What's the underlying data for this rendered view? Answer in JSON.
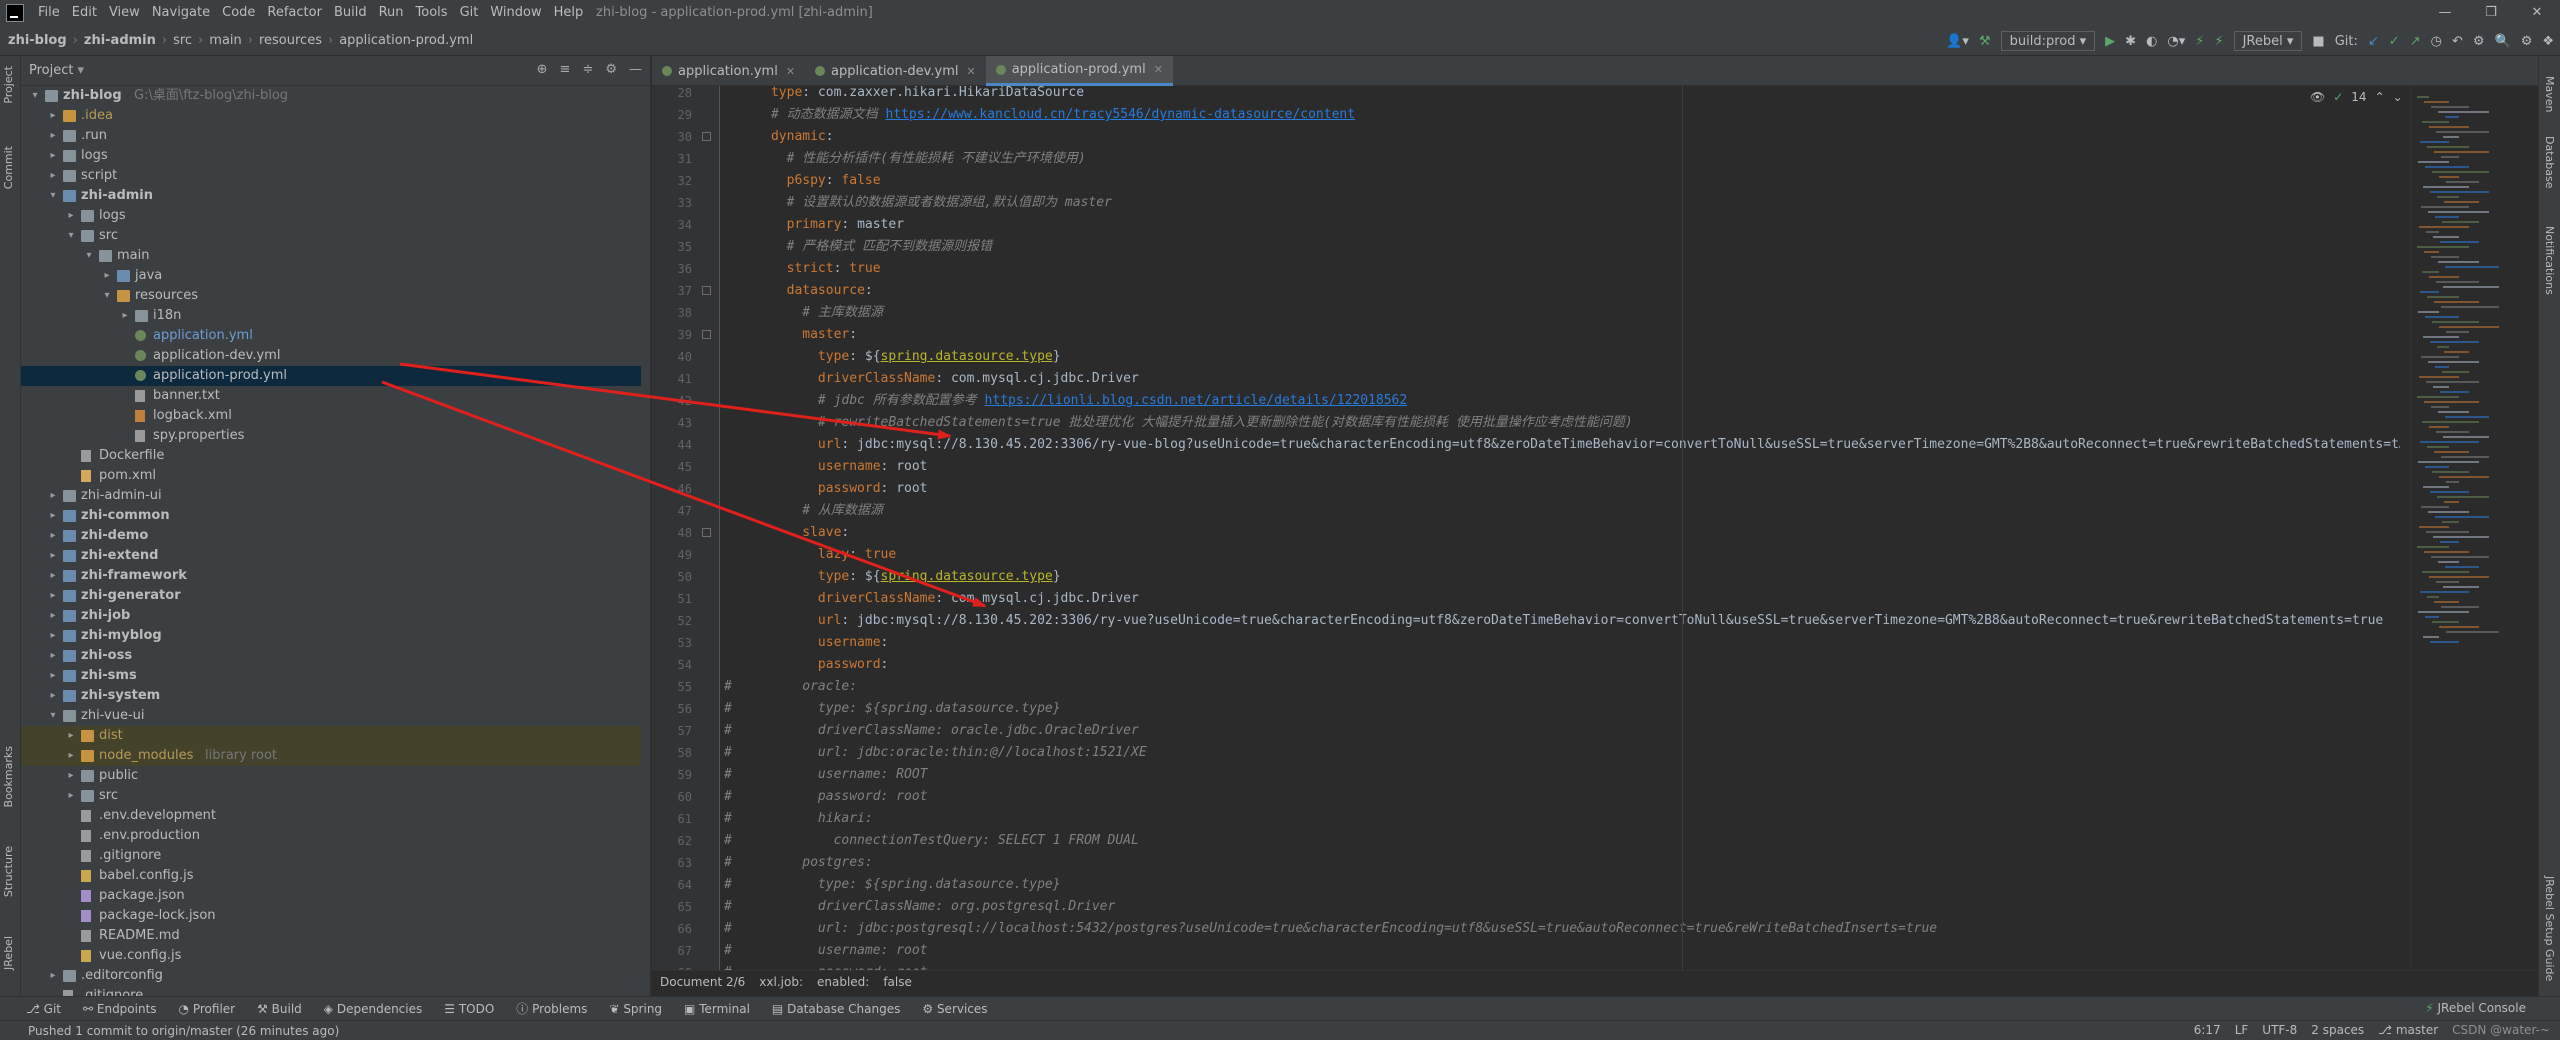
{
  "window": {
    "title": "zhi-blog - application-prod.yml [zhi-admin]",
    "menu": [
      "File",
      "Edit",
      "View",
      "Navigate",
      "Code",
      "Refactor",
      "Build",
      "Run",
      "Tools",
      "Git",
      "Window",
      "Help"
    ],
    "controls": [
      "—",
      "❐",
      "✕"
    ]
  },
  "navbar": {
    "crumbs": [
      "zhi-blog",
      "zhi-admin",
      "src",
      "main",
      "resources",
      "application-prod.yml"
    ],
    "run_config": "build:prod",
    "jrebel": "JRebel",
    "git_label": "Git:"
  },
  "project": {
    "title": "Project",
    "tree": [
      {
        "depth": 0,
        "arrow": "v",
        "icon": "folder",
        "label": "zhi-blog",
        "extra": "G:\\桌面\\ftz-blog\\zhi-blog",
        "cls": "bold"
      },
      {
        "depth": 1,
        "arrow": ">",
        "icon": "folder-orange",
        "label": ".idea",
        "cls": "excluded"
      },
      {
        "depth": 1,
        "arrow": ">",
        "icon": "folder",
        "label": ".run",
        "cls": ""
      },
      {
        "depth": 1,
        "arrow": ">",
        "icon": "folder",
        "label": "logs",
        "cls": ""
      },
      {
        "depth": 1,
        "arrow": ">",
        "icon": "folder",
        "label": "script",
        "cls": ""
      },
      {
        "depth": 1,
        "arrow": "v",
        "icon": "folder-blue",
        "label": "zhi-admin",
        "cls": "bold"
      },
      {
        "depth": 2,
        "arrow": ">",
        "icon": "folder",
        "label": "logs",
        "cls": ""
      },
      {
        "depth": 2,
        "arrow": "v",
        "icon": "folder",
        "label": "src",
        "cls": ""
      },
      {
        "depth": 3,
        "arrow": "v",
        "icon": "folder",
        "label": "main",
        "cls": ""
      },
      {
        "depth": 4,
        "arrow": ">",
        "icon": "folder-blue",
        "label": "java",
        "cls": ""
      },
      {
        "depth": 4,
        "arrow": "v",
        "icon": "folder-orange",
        "label": "resources",
        "cls": ""
      },
      {
        "depth": 5,
        "arrow": ">",
        "icon": "folder",
        "label": "i18n",
        "cls": ""
      },
      {
        "depth": 5,
        "arrow": "",
        "icon": "yml",
        "label": "application.yml",
        "cls": "blue-t"
      },
      {
        "depth": 5,
        "arrow": "",
        "icon": "yml",
        "label": "application-dev.yml",
        "cls": ""
      },
      {
        "depth": 5,
        "arrow": "",
        "icon": "yml",
        "label": "application-prod.yml",
        "cls": "",
        "selected": true
      },
      {
        "depth": 5,
        "arrow": "",
        "icon": "txt",
        "label": "banner.txt",
        "cls": ""
      },
      {
        "depth": 5,
        "arrow": "",
        "icon": "xml",
        "label": "logback.xml",
        "cls": ""
      },
      {
        "depth": 5,
        "arrow": "",
        "icon": "txt",
        "label": "spy.properties",
        "cls": ""
      },
      {
        "depth": 2,
        "arrow": "",
        "icon": "txt",
        "label": "Dockerfile",
        "cls": ""
      },
      {
        "depth": 2,
        "arrow": "",
        "icon": "m",
        "label": "pom.xml",
        "cls": ""
      },
      {
        "depth": 1,
        "arrow": ">",
        "icon": "folder",
        "label": "zhi-admin-ui",
        "cls": ""
      },
      {
        "depth": 1,
        "arrow": ">",
        "icon": "folder-blue",
        "label": "zhi-common",
        "cls": "bold"
      },
      {
        "depth": 1,
        "arrow": ">",
        "icon": "folder-blue",
        "label": "zhi-demo",
        "cls": "bold"
      },
      {
        "depth": 1,
        "arrow": ">",
        "icon": "folder-blue",
        "label": "zhi-extend",
        "cls": "bold"
      },
      {
        "depth": 1,
        "arrow": ">",
        "icon": "folder-blue",
        "label": "zhi-framework",
        "cls": "bold"
      },
      {
        "depth": 1,
        "arrow": ">",
        "icon": "folder-blue",
        "label": "zhi-generator",
        "cls": "bold"
      },
      {
        "depth": 1,
        "arrow": ">",
        "icon": "folder-blue",
        "label": "zhi-job",
        "cls": "bold"
      },
      {
        "depth": 1,
        "arrow": ">",
        "icon": "folder-blue",
        "label": "zhi-myblog",
        "cls": "bold"
      },
      {
        "depth": 1,
        "arrow": ">",
        "icon": "folder-blue",
        "label": "zhi-oss",
        "cls": "bold"
      },
      {
        "depth": 1,
        "arrow": ">",
        "icon": "folder-blue",
        "label": "zhi-sms",
        "cls": "bold"
      },
      {
        "depth": 1,
        "arrow": ">",
        "icon": "folder-blue",
        "label": "zhi-system",
        "cls": "bold"
      },
      {
        "depth": 1,
        "arrow": "v",
        "icon": "folder",
        "label": "zhi-vue-ui",
        "cls": ""
      },
      {
        "depth": 2,
        "arrow": ">",
        "icon": "folder-orange",
        "label": "dist",
        "cls": "excluded",
        "bg": "excluded"
      },
      {
        "depth": 2,
        "arrow": ">",
        "icon": "folder-orange",
        "label": "node_modules",
        "extra": "library root",
        "cls": "excluded",
        "bg": "excluded"
      },
      {
        "depth": 2,
        "arrow": ">",
        "icon": "folder",
        "label": "public",
        "cls": ""
      },
      {
        "depth": 2,
        "arrow": ">",
        "icon": "folder",
        "label": "src",
        "cls": ""
      },
      {
        "depth": 2,
        "arrow": "",
        "icon": "txt",
        "label": ".env.development",
        "cls": ""
      },
      {
        "depth": 2,
        "arrow": "",
        "icon": "txt",
        "label": ".env.production",
        "cls": ""
      },
      {
        "depth": 2,
        "arrow": "",
        "icon": "txt",
        "label": ".gitignore",
        "cls": ""
      },
      {
        "depth": 2,
        "arrow": "",
        "icon": "js",
        "label": "babel.config.js",
        "cls": ""
      },
      {
        "depth": 2,
        "arrow": "",
        "icon": "json",
        "label": "package.json",
        "cls": ""
      },
      {
        "depth": 2,
        "arrow": "",
        "icon": "json",
        "label": "package-lock.json",
        "cls": ""
      },
      {
        "depth": 2,
        "arrow": "",
        "icon": "txt",
        "label": "README.md",
        "cls": ""
      },
      {
        "depth": 2,
        "arrow": "",
        "icon": "js",
        "label": "vue.config.js",
        "cls": ""
      },
      {
        "depth": 1,
        "arrow": ">",
        "icon": "folder",
        "label": ".editorconfig",
        "cls": ""
      },
      {
        "depth": 1,
        "arrow": "",
        "icon": "txt",
        "label": ".gitignore",
        "cls": ""
      }
    ]
  },
  "tabs": [
    {
      "label": "application.yml",
      "active": false
    },
    {
      "label": "application-dev.yml",
      "active": false
    },
    {
      "label": "application-prod.yml",
      "active": true
    }
  ],
  "editor": {
    "inspection_count": "14",
    "lines": [
      {
        "n": "28",
        "segs": [
          [
            "t",
            "      "
          ],
          [
            "k",
            "type"
          ],
          [
            "t",
            ": com.zaxxer.hikari.HikariDataSource"
          ]
        ]
      },
      {
        "n": "29",
        "segs": [
          [
            "t",
            "      "
          ],
          [
            "c",
            "# 动态数据源文档 "
          ],
          [
            "u",
            "https://www.kancloud.cn/tracy5546/dynamic-datasource/content"
          ]
        ]
      },
      {
        "n": "30",
        "segs": [
          [
            "t",
            "      "
          ],
          [
            "k",
            "dynamic"
          ],
          [
            "t",
            ":"
          ]
        ]
      },
      {
        "n": "31",
        "segs": [
          [
            "t",
            "        "
          ],
          [
            "c",
            "# 性能分析插件(有性能损耗 不建议生产环境使用)"
          ]
        ]
      },
      {
        "n": "32",
        "segs": [
          [
            "t",
            "        "
          ],
          [
            "k",
            "p6spy"
          ],
          [
            "t",
            ": "
          ],
          [
            "k",
            "false"
          ]
        ]
      },
      {
        "n": "33",
        "segs": [
          [
            "t",
            "        "
          ],
          [
            "c",
            "# 设置默认的数据源或者数据源组,默认值即为 master"
          ]
        ]
      },
      {
        "n": "34",
        "segs": [
          [
            "t",
            "        "
          ],
          [
            "k",
            "primary"
          ],
          [
            "t",
            ": master"
          ]
        ]
      },
      {
        "n": "35",
        "segs": [
          [
            "t",
            "        "
          ],
          [
            "c",
            "# 严格模式 匹配不到数据源则报错"
          ]
        ]
      },
      {
        "n": "36",
        "segs": [
          [
            "t",
            "        "
          ],
          [
            "k",
            "strict"
          ],
          [
            "t",
            ": "
          ],
          [
            "k",
            "true"
          ]
        ]
      },
      {
        "n": "37",
        "segs": [
          [
            "t",
            "        "
          ],
          [
            "k",
            "datasource"
          ],
          [
            "t",
            ":"
          ]
        ]
      },
      {
        "n": "38",
        "segs": [
          [
            "t",
            "          "
          ],
          [
            "c",
            "# 主库数据源"
          ]
        ]
      },
      {
        "n": "39",
        "segs": [
          [
            "t",
            "          "
          ],
          [
            "k",
            "master"
          ],
          [
            "t",
            ":"
          ]
        ]
      },
      {
        "n": "40",
        "segs": [
          [
            "t",
            "            "
          ],
          [
            "k",
            "type"
          ],
          [
            "t",
            ": ${"
          ],
          [
            "ph",
            "spring.datasource.type"
          ],
          [
            "t",
            "}"
          ]
        ]
      },
      {
        "n": "41",
        "segs": [
          [
            "t",
            "            "
          ],
          [
            "k",
            "driverClassName"
          ],
          [
            "t",
            ": com.mysql.cj.jdbc.Driver"
          ]
        ]
      },
      {
        "n": "42",
        "segs": [
          [
            "t",
            "            "
          ],
          [
            "c",
            "# jdbc 所有参数配置参考 "
          ],
          [
            "u",
            "https://lionli.blog.csdn.net/article/details/122018562"
          ]
        ]
      },
      {
        "n": "43",
        "segs": [
          [
            "t",
            "            "
          ],
          [
            "c",
            "# rewriteBatchedStatements=true 批处理优化 大幅提升批量插入更新删除性能(对数据库有性能损耗 使用批量操作应考虑性能问题)"
          ]
        ]
      },
      {
        "n": "44",
        "segs": [
          [
            "t",
            "            "
          ],
          [
            "k",
            "url"
          ],
          [
            "t",
            ": jdbc:mysql://8.130.45.202:3306/ry-vue-blog?useUnicode=true&characterEncoding=utf8&zeroDateTimeBehavior=convertToNull&useSSL=true&serverTimezone=GMT%2B8&autoReconnect=true&rewriteBatchedStatements=t…"
          ]
        ]
      },
      {
        "n": "45",
        "segs": [
          [
            "t",
            "            "
          ],
          [
            "k",
            "username"
          ],
          [
            "t",
            ": root"
          ]
        ]
      },
      {
        "n": "46",
        "segs": [
          [
            "t",
            "            "
          ],
          [
            "k",
            "password"
          ],
          [
            "t",
            ": root"
          ]
        ]
      },
      {
        "n": "47",
        "segs": [
          [
            "t",
            "          "
          ],
          [
            "c",
            "# 从库数据源"
          ]
        ]
      },
      {
        "n": "48",
        "segs": [
          [
            "t",
            "          "
          ],
          [
            "k",
            "slave"
          ],
          [
            "t",
            ":"
          ]
        ]
      },
      {
        "n": "49",
        "segs": [
          [
            "t",
            "            "
          ],
          [
            "k",
            "lazy"
          ],
          [
            "t",
            ": "
          ],
          [
            "k",
            "true"
          ]
        ]
      },
      {
        "n": "50",
        "segs": [
          [
            "t",
            "            "
          ],
          [
            "k",
            "type"
          ],
          [
            "t",
            ": ${"
          ],
          [
            "ph",
            "spring.datasource.type"
          ],
          [
            "t",
            "}"
          ]
        ]
      },
      {
        "n": "51",
        "segs": [
          [
            "t",
            "            "
          ],
          [
            "k",
            "driverClassName"
          ],
          [
            "t",
            ": com.mysql.cj.jdbc.Driver"
          ]
        ]
      },
      {
        "n": "52",
        "segs": [
          [
            "t",
            "            "
          ],
          [
            "k",
            "url"
          ],
          [
            "t",
            ": jdbc:mysql://8.130.45.202:3306/ry-vue?useUnicode=true&characterEncoding=utf8&zeroDateTimeBehavior=convertToNull&useSSL=true&serverTimezone=GMT%2B8&autoReconnect=true&rewriteBatchedStatements=true"
          ]
        ]
      },
      {
        "n": "53",
        "segs": [
          [
            "t",
            "            "
          ],
          [
            "k",
            "username"
          ],
          [
            "t",
            ":"
          ]
        ]
      },
      {
        "n": "54",
        "segs": [
          [
            "t",
            "            "
          ],
          [
            "k",
            "password"
          ],
          [
            "t",
            ":"
          ]
        ]
      },
      {
        "n": "55",
        "segs": [
          [
            "m",
            "#         oracle:"
          ]
        ]
      },
      {
        "n": "56",
        "segs": [
          [
            "m",
            "#           type: ${spring.datasource.type}"
          ]
        ]
      },
      {
        "n": "57",
        "segs": [
          [
            "m",
            "#           driverClassName: oracle.jdbc.OracleDriver"
          ]
        ]
      },
      {
        "n": "58",
        "segs": [
          [
            "m",
            "#           url: jdbc:oracle:thin:@//localhost:1521/XE"
          ]
        ]
      },
      {
        "n": "59",
        "segs": [
          [
            "m",
            "#           username: ROOT"
          ]
        ]
      },
      {
        "n": "60",
        "segs": [
          [
            "m",
            "#           password: root"
          ]
        ]
      },
      {
        "n": "61",
        "segs": [
          [
            "m",
            "#           hikari:"
          ]
        ]
      },
      {
        "n": "62",
        "segs": [
          [
            "m",
            "#             connectionTestQuery: SELECT 1 FROM DUAL"
          ]
        ]
      },
      {
        "n": "63",
        "segs": [
          [
            "m",
            "#         postgres:"
          ]
        ]
      },
      {
        "n": "64",
        "segs": [
          [
            "m",
            "#           type: ${spring.datasource.type}"
          ]
        ]
      },
      {
        "n": "65",
        "segs": [
          [
            "m",
            "#           driverClassName: org.postgresql.Driver"
          ]
        ]
      },
      {
        "n": "66",
        "segs": [
          [
            "m",
            "#           url: jdbc:postgresql://localhost:5432/postgres?useUnicode=true&characterEncoding=utf8&useSSL=true&autoReconnect=true&reWriteBatchedInserts=true"
          ]
        ]
      },
      {
        "n": "67",
        "segs": [
          [
            "m",
            "#           username: root"
          ]
        ]
      },
      {
        "n": "68",
        "segs": [
          [
            "m",
            "#           password: root"
          ]
        ]
      }
    ]
  },
  "editor_breadcrumb": [
    "Document 2/6",
    "xxl.job:",
    "enabled:",
    "false"
  ],
  "tool_windows": [
    "Git",
    "Endpoints",
    "Profiler",
    "Build",
    "Dependencies",
    "TODO",
    "Problems",
    "Spring",
    "Terminal",
    "Database Changes",
    "Services"
  ],
  "jrebel_console": "JRebel Console",
  "status": {
    "message": "Pushed 1 commit to origin/master (26 minutes ago)",
    "position": "6:17",
    "line_sep": "LF",
    "encoding": "UTF-8",
    "indent": "2 spaces",
    "branch": "master",
    "watermark": "CSDN @water-~"
  },
  "left_strip": [
    "Project",
    "Commit",
    "Bookmarks",
    "Structure",
    "JRebel"
  ],
  "right_strip": [
    "Maven",
    "Database",
    "Notifications",
    "JRebel Setup Guide"
  ],
  "colors": {
    "accent": "#4a88c7",
    "arrow": "#e0201a",
    "selection": "#0d293e"
  }
}
